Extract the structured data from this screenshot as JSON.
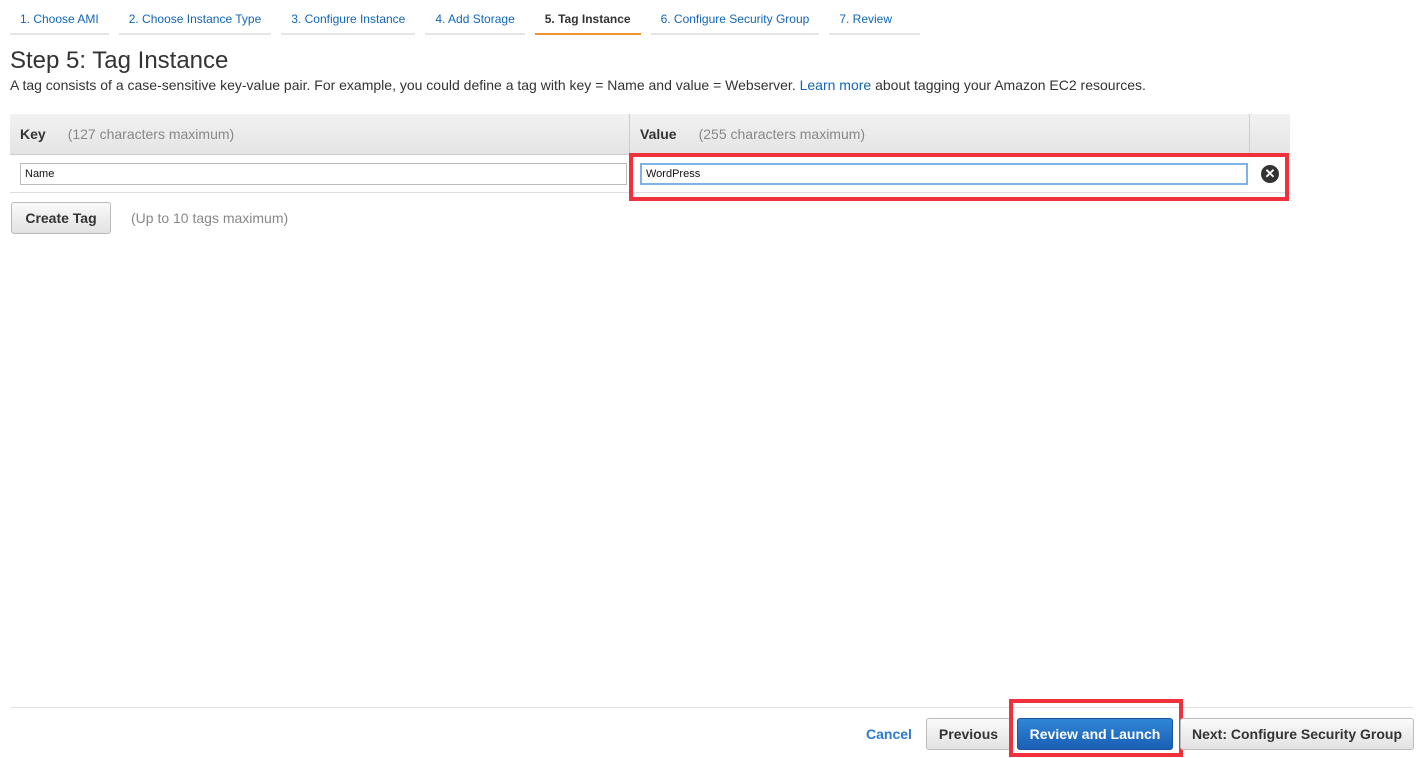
{
  "wizard_steps": [
    "1. Choose AMI",
    "2. Choose Instance Type",
    "3. Configure Instance",
    "4. Add Storage",
    "5. Tag Instance",
    "6. Configure Security Group",
    "7. Review"
  ],
  "active_step": 4,
  "title": "Step 5: Tag Instance",
  "description": {
    "before": "A tag consists of a case-sensitive key-value pair. For example, you could define a tag with key = Name and value = Webserver. ",
    "link": "Learn more",
    "after": " about tagging your Amazon EC2 resources."
  },
  "table": {
    "key_header": "Key",
    "key_hint": "(127 characters maximum)",
    "value_header": "Value",
    "value_hint": "(255 characters maximum)",
    "rows": [
      {
        "key": "Name",
        "value": "WordPress"
      }
    ]
  },
  "create_tag_label": "Create Tag",
  "create_tag_hint": "(Up to 10 tags maximum)",
  "footer": {
    "cancel": "Cancel",
    "previous": "Previous",
    "review_launch": "Review and Launch",
    "next": "Next: Configure Security Group"
  }
}
